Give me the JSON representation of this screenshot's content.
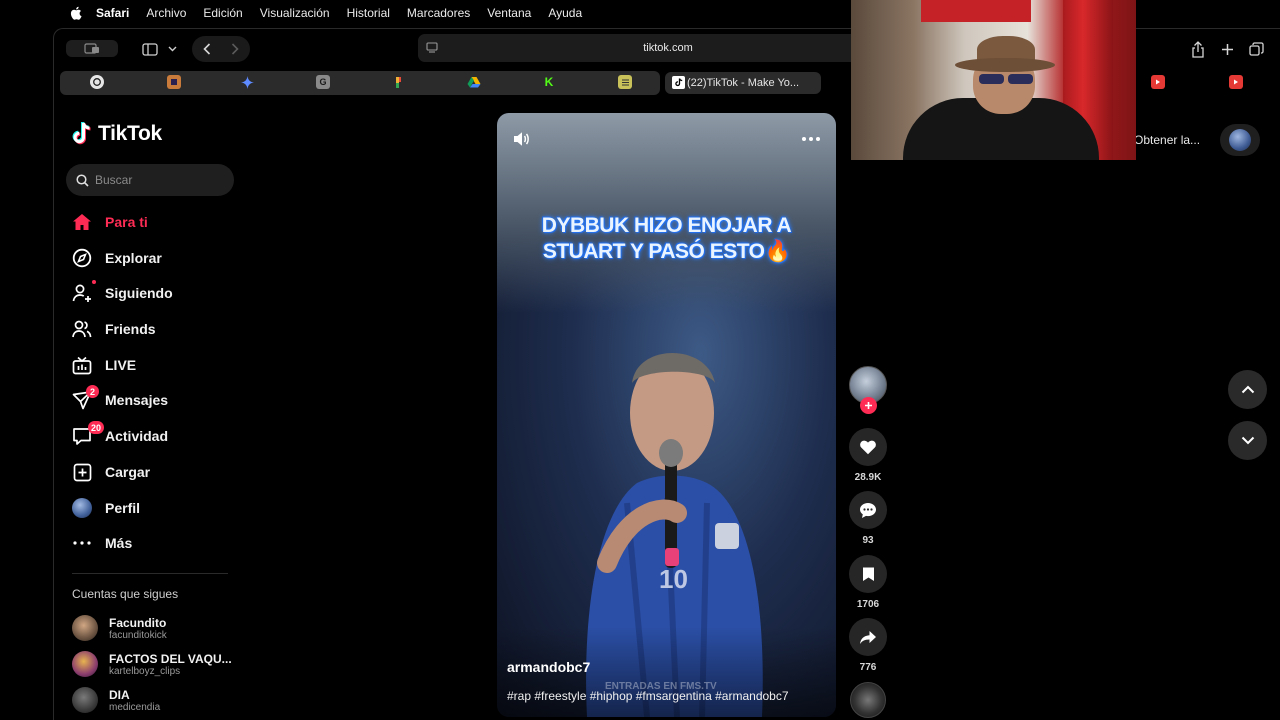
{
  "menubar": {
    "app": "Safari",
    "items": [
      "Archivo",
      "Edición",
      "Visualización",
      "Historial",
      "Marcadores",
      "Ventana",
      "Ayuda"
    ]
  },
  "browser": {
    "url": "tiktok.com",
    "active_tab_title": "(22)TikTok - Make Yo...",
    "favorites": [
      {
        "icon": "openai-icon",
        "color": "#e6e6e6"
      },
      {
        "icon": "app-icon",
        "color": "#c87b3a"
      },
      {
        "icon": "gemini-icon",
        "color": "#5e8bff"
      },
      {
        "icon": "g-icon",
        "color": "#8a8a8a",
        "glyph": "G"
      },
      {
        "icon": "color-icon",
        "color": "#f2b134"
      },
      {
        "icon": "drive-icon",
        "color": "#34a853"
      },
      {
        "icon": "kick-icon",
        "color": "#53fc18",
        "glyph": "K"
      },
      {
        "icon": "sheet-icon",
        "color": "#c9c25a"
      }
    ]
  },
  "tiktok": {
    "logo": "TikTok",
    "search_placeholder": "Buscar",
    "nav": [
      {
        "label": "Para ti",
        "icon": "home-icon",
        "active": true
      },
      {
        "label": "Explorar",
        "icon": "compass-icon"
      },
      {
        "label": "Siguiendo",
        "icon": "following-icon"
      },
      {
        "label": "Friends",
        "icon": "friends-icon"
      },
      {
        "label": "LIVE",
        "icon": "live-icon"
      },
      {
        "label": "Mensajes",
        "icon": "messages-icon",
        "badge": "2"
      },
      {
        "label": "Actividad",
        "icon": "activity-icon",
        "badge": "20"
      },
      {
        "label": "Cargar",
        "icon": "upload-icon"
      },
      {
        "label": "Perfil",
        "icon": "profile-avatar"
      },
      {
        "label": "Más",
        "icon": "more-icon"
      }
    ],
    "following_title": "Cuentas que sigues",
    "following": [
      {
        "name": "Facundito",
        "handle": "facunditokick"
      },
      {
        "name": "FACTOS DEL VAQU...",
        "handle": "kartelboyz_clips"
      },
      {
        "name": "DIA",
        "handle": "medicendia"
      }
    ],
    "get_app": "Obtener la..."
  },
  "video": {
    "overlay_line1": "DYBBUK HIZO ENOJAR A",
    "overlay_line2": "STUART Y PASÓ ESTO🔥",
    "author": "armandobc7",
    "hashtags": "#rap #freestyle #hiphop #fmsargentina #armandobc7",
    "watermark": "ENTRADAS EN FMS.TV",
    "likes": "28.9K",
    "comments": "93",
    "saves": "1706",
    "shares": "776"
  }
}
